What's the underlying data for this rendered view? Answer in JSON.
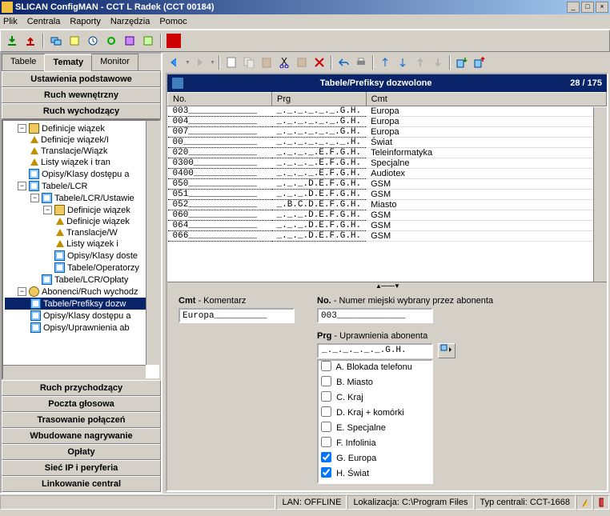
{
  "window": {
    "title": "SLICAN ConfigMAN - CCT L Radek (CCT 00184)"
  },
  "menu": {
    "items": [
      "Plik",
      "Centrala",
      "Raporty",
      "Narzędzia",
      "Pomoc"
    ]
  },
  "tabs": {
    "t0": "Tabele",
    "t1": "Tematy",
    "t2": "Monitor"
  },
  "nav": {
    "top0": "Ustawienia podstawowe",
    "top1": "Ruch wewnętrzny",
    "top2": "Ruch wychodzący",
    "bot0": "Ruch przychodzący",
    "bot1": "Poczta głosowa",
    "bot2": "Trasowanie połączeń",
    "bot3": "Wbudowane nagrywanie",
    "bot4": "Opłaty",
    "bot5": "Sieć IP i peryferia",
    "bot6": "Linkowanie central"
  },
  "tree": {
    "n0": "Definicje wiązek",
    "n1": "Definicje wiązek/I",
    "n2": "Translacje/Wiązk",
    "n3": "Listy wiązek i tran",
    "n4": "Opisy/Klasy dostępu a",
    "n5": "Tabele/LCR",
    "n6": "Tabele/LCR/Ustawie",
    "n7": "Definicje wiązek",
    "n8": "Definicje wiązek",
    "n9": "Translacje/W",
    "n10": "Listy wiązek i",
    "n11": "Opisy/Klasy doste",
    "n12": "Tabele/Operatorzy",
    "n13": "Tabele/LCR/Opłaty",
    "n14": "Abonenci/Ruch wychodz",
    "n15": "Tabele/Prefiksy dozw",
    "n16": "Opisy/Klasy dostępu a",
    "n17": "Opisy/Uprawnienia ab"
  },
  "sheet": {
    "title": "Tabele/Prefiksy dozwolone",
    "count": "28 / 175",
    "cols": {
      "c0": "No.",
      "c1": "Prg",
      "c2": "Cmt"
    },
    "rows": [
      {
        "no": "003_____________",
        "prg": "_._._._._._.G.H.",
        "cmt": "Europa"
      },
      {
        "no": "004_____________",
        "prg": "_._._._._._.G.H.",
        "cmt": "Europa"
      },
      {
        "no": "007_____________",
        "prg": "_._._._._._.G.H.",
        "cmt": "Europa"
      },
      {
        "no": "00______________",
        "prg": "_._._._._._._.H.",
        "cmt": "Świat"
      },
      {
        "no": "020_____________",
        "prg": "_._._._.E.F.G.H.",
        "cmt": "Teleinformatyka"
      },
      {
        "no": "0300____________",
        "prg": "_._._._.E.F.G.H.",
        "cmt": "Specjalne"
      },
      {
        "no": "0400____________",
        "prg": "_._._._.E.F.G.H.",
        "cmt": "Audiotex"
      },
      {
        "no": "050_____________",
        "prg": "_._._.D.E.F.G.H.",
        "cmt": "GSM"
      },
      {
        "no": "051_____________",
        "prg": "_._._.D.E.F.G.H.",
        "cmt": "GSM"
      },
      {
        "no": "052_____________",
        "prg": "_.B.C.D.E.F.G.H.",
        "cmt": "Miasto"
      },
      {
        "no": "060_____________",
        "prg": "_._._.D.E.F.G.H.",
        "cmt": "GSM"
      },
      {
        "no": "064_____________",
        "prg": "_._._.D.E.F.G.H.",
        "cmt": "GSM"
      },
      {
        "no": "066_____________",
        "prg": "_._._.D.E.F.G.H.",
        "cmt": "GSM"
      }
    ]
  },
  "form": {
    "cmt_label_b": "Cmt",
    "cmt_label": " - Komentarz",
    "cmt_value": "Europa__________",
    "no_label_b": "No.",
    "no_label": " - Numer miejski wybrany przez abonenta",
    "no_value": "003_____________",
    "prg_label_b": "Prg",
    "prg_label": " - Uprawnienia abonenta",
    "prg_value": "_._._._._._.G.H.",
    "opts": {
      "a": "A. Blokada telefonu",
      "b": "B. Miasto",
      "c": "C. Kraj",
      "d": "D. Kraj + komórki",
      "e": "E. Specjalne",
      "f": "F. Infolinia",
      "g": "G. Europa",
      "h": "H. Świat"
    }
  },
  "status": {
    "lan": "LAN: OFFLINE",
    "loc": "Lokalizacja: C:\\Program Files",
    "typ": "Typ centrali: CCT-1668"
  }
}
